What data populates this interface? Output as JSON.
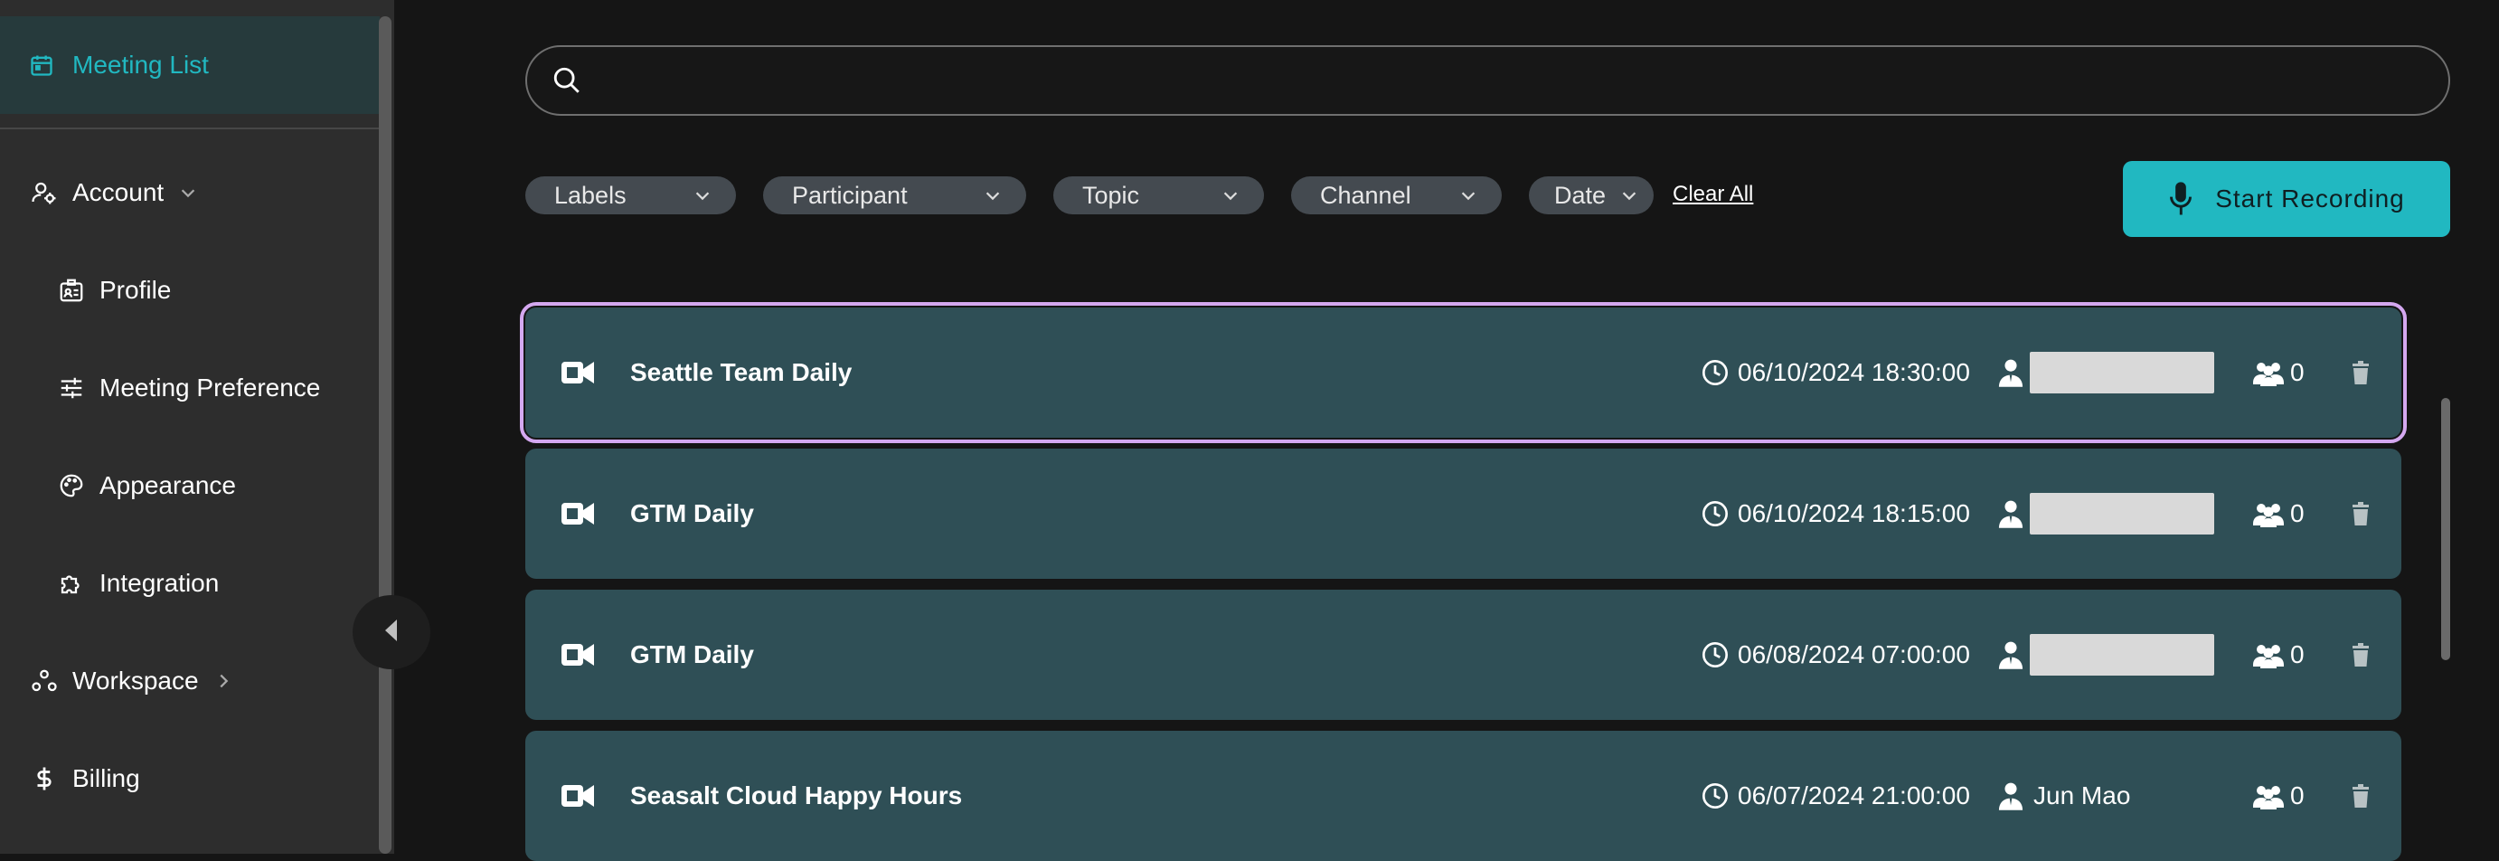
{
  "sidebar": {
    "active_item": {
      "label": "Meeting List",
      "icon": "calendar-icon"
    },
    "items": [
      {
        "label": "Account",
        "icon": "user-settings-icon"
      },
      {
        "label": "Profile",
        "icon": "id-card-icon"
      },
      {
        "label": "Meeting Preference",
        "icon": "sliders-icon"
      },
      {
        "label": "Appearance",
        "icon": "palette-icon"
      },
      {
        "label": "Integration",
        "icon": "puzzle-icon"
      },
      {
        "label": "Workspace",
        "icon": "workspace-icon"
      },
      {
        "label": "Billing",
        "icon": "dollar-icon"
      }
    ]
  },
  "search": {
    "placeholder": "",
    "value": ""
  },
  "filters": [
    {
      "label": "Labels"
    },
    {
      "label": "Participant"
    },
    {
      "label": "Topic"
    },
    {
      "label": "Channel"
    },
    {
      "label": "Date"
    }
  ],
  "clear_all_label": "Clear All",
  "record_button_label": "Start Recording",
  "meetings": [
    {
      "title": "Seattle Team Daily",
      "datetime": "06/10/2024 18:30:00",
      "host": "",
      "participants": "0"
    },
    {
      "title": "GTM Daily",
      "datetime": "06/10/2024 18:15:00",
      "host": "",
      "participants": "0"
    },
    {
      "title": "GTM Daily",
      "datetime": "06/08/2024 07:00:00",
      "host": "",
      "participants": "0"
    },
    {
      "title": "Seasalt Cloud Happy Hours",
      "datetime": "06/07/2024 21:00:00",
      "host": "Jun Mao",
      "participants": "0"
    }
  ],
  "colors": {
    "accent": "#21b8c1",
    "row_background": "#2f4f56",
    "selected_outline": "#d4a8f0",
    "sidebar_background": "#2d2d2d",
    "page_background": "#151515"
  }
}
